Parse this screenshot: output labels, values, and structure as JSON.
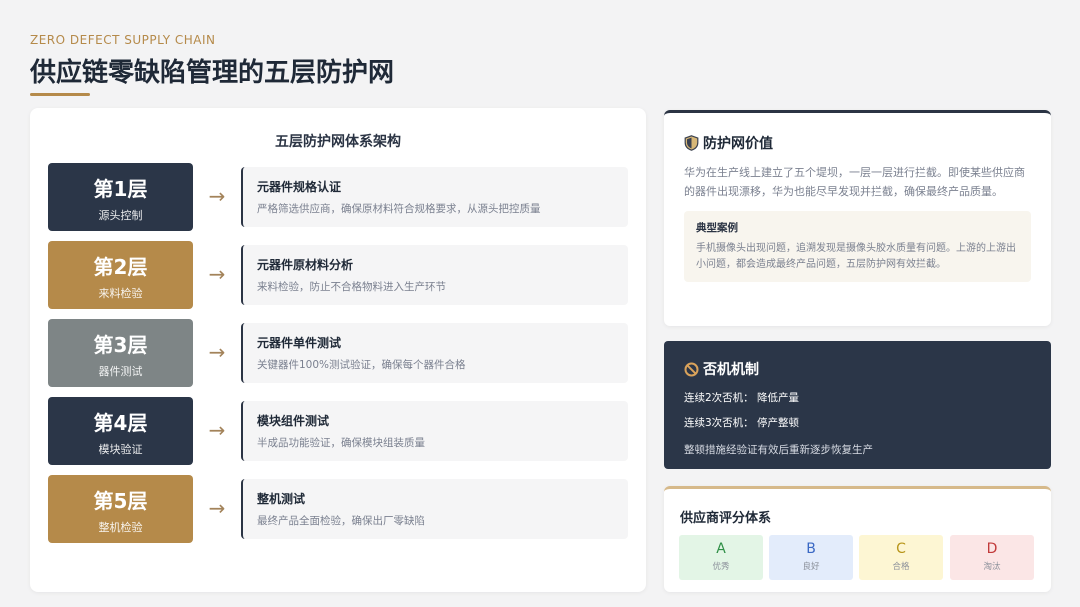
{
  "header": {
    "eyebrow": "ZERO DEFECT SUPPLY CHAIN",
    "title": "供应链零缺陷管理的五层防护网"
  },
  "architecture": {
    "title": "五层防护网体系架构",
    "layers": [
      {
        "name": "第1层",
        "sub": "源头控制",
        "title": "元器件规格认证",
        "desc": "严格筛选供应商，确保原材料符合规格要求，从源头把控质量",
        "color": "#2b3648"
      },
      {
        "name": "第2层",
        "sub": "来料检验",
        "title": "元器件原材料分析",
        "desc": "来料检验，防止不合格物料进入生产环节",
        "color": "#b58a4a"
      },
      {
        "name": "第3层",
        "sub": "器件测试",
        "title": "元器件单件测试",
        "desc": "关键器件100%测试验证，确保每个器件合格",
        "color": "#7e8586"
      },
      {
        "name": "第4层",
        "sub": "模块验证",
        "title": "模块组件测试",
        "desc": "半成品功能验证，确保模块组装质量",
        "color": "#2b3648"
      },
      {
        "name": "第5层",
        "sub": "整机检验",
        "title": "整机测试",
        "desc": "最终产品全面检验，确保出厂零缺陷",
        "color": "#b58a4a"
      }
    ]
  },
  "value": {
    "title": "防护网价值",
    "text": "华为在生产线上建立了五个堤坝，一层一层进行拦截。即使某些供应商的器件出现漂移，华为也能尽早发现并拦截，确保最终产品质量。",
    "case_title": "典型案例",
    "case_text": "手机摄像头出现问题，追溯发现是摄像头胶水质量有问题。上游的上游出小问题，都会造成最终产品问题，五层防护网有效拦截。"
  },
  "veto": {
    "title": "否机机制",
    "line1": "连续2次否机： 降低产量",
    "line2": "连续3次否机： 停产整顿",
    "line3": "整顿措施经验证有效后重新逐步恢复生产"
  },
  "rating": {
    "title": "供应商评分体系",
    "grades": [
      {
        "letter": "A",
        "label": "优秀",
        "bg": "#e3f5e6",
        "fg": "#2f8f46"
      },
      {
        "letter": "B",
        "label": "良好",
        "bg": "#e3ecfb",
        "fg": "#3a68c4"
      },
      {
        "letter": "C",
        "label": "合格",
        "bg": "#fdf6d3",
        "fg": "#b8961a"
      },
      {
        "letter": "D",
        "label": "淘汰",
        "bg": "#fbe6e6",
        "fg": "#c23b3b"
      }
    ]
  },
  "colors": {
    "accent": "#b58a4a",
    "navy": "#2b3648"
  }
}
